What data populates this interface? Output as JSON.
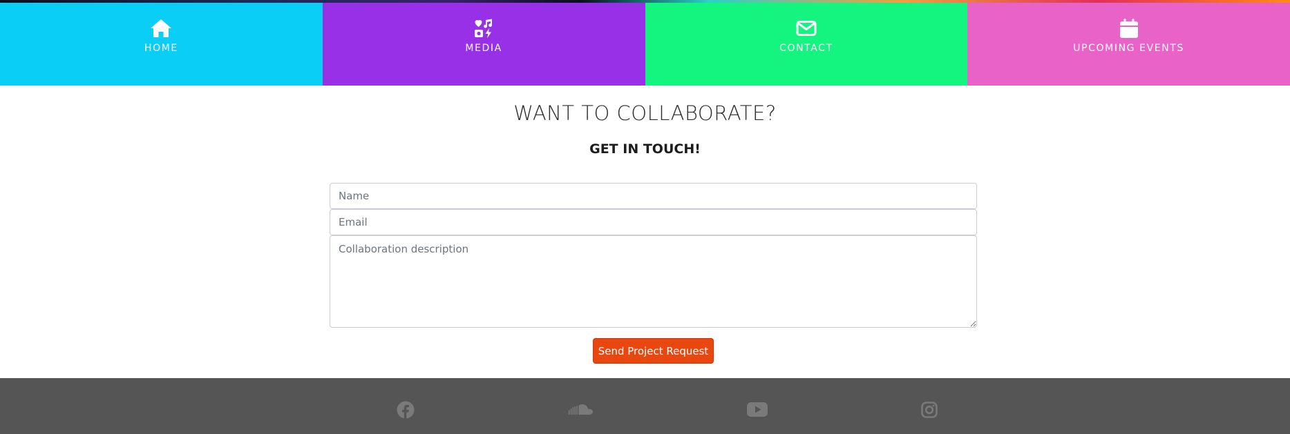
{
  "nav": {
    "items": [
      {
        "label": "HOME",
        "icon": "home-icon",
        "color": "#0acef5"
      },
      {
        "label": "MEDIA",
        "icon": "media-icon",
        "color": "#9830e8"
      },
      {
        "label": "CONTACT",
        "icon": "envelope-icon",
        "color": "#13f57f"
      },
      {
        "label": "UPCOMING EVENTS",
        "icon": "calendar-icon",
        "color": "#e862c8"
      }
    ]
  },
  "contact": {
    "heading": "WANT TO COLLABORATE?",
    "subheading": "GET IN TOUCH!",
    "fields": {
      "name": {
        "value": "",
        "placeholder": "Name"
      },
      "email": {
        "value": "",
        "placeholder": "Email"
      },
      "description": {
        "value": "",
        "placeholder": "Collaboration description"
      }
    },
    "submit_label": "Send Project Request",
    "accent_color": "#e84810"
  },
  "footer": {
    "background": "#555555",
    "icon_color": "#7a7a7a",
    "social": [
      "facebook-icon",
      "soundcloud-icon",
      "youtube-icon",
      "instagram-icon"
    ]
  }
}
